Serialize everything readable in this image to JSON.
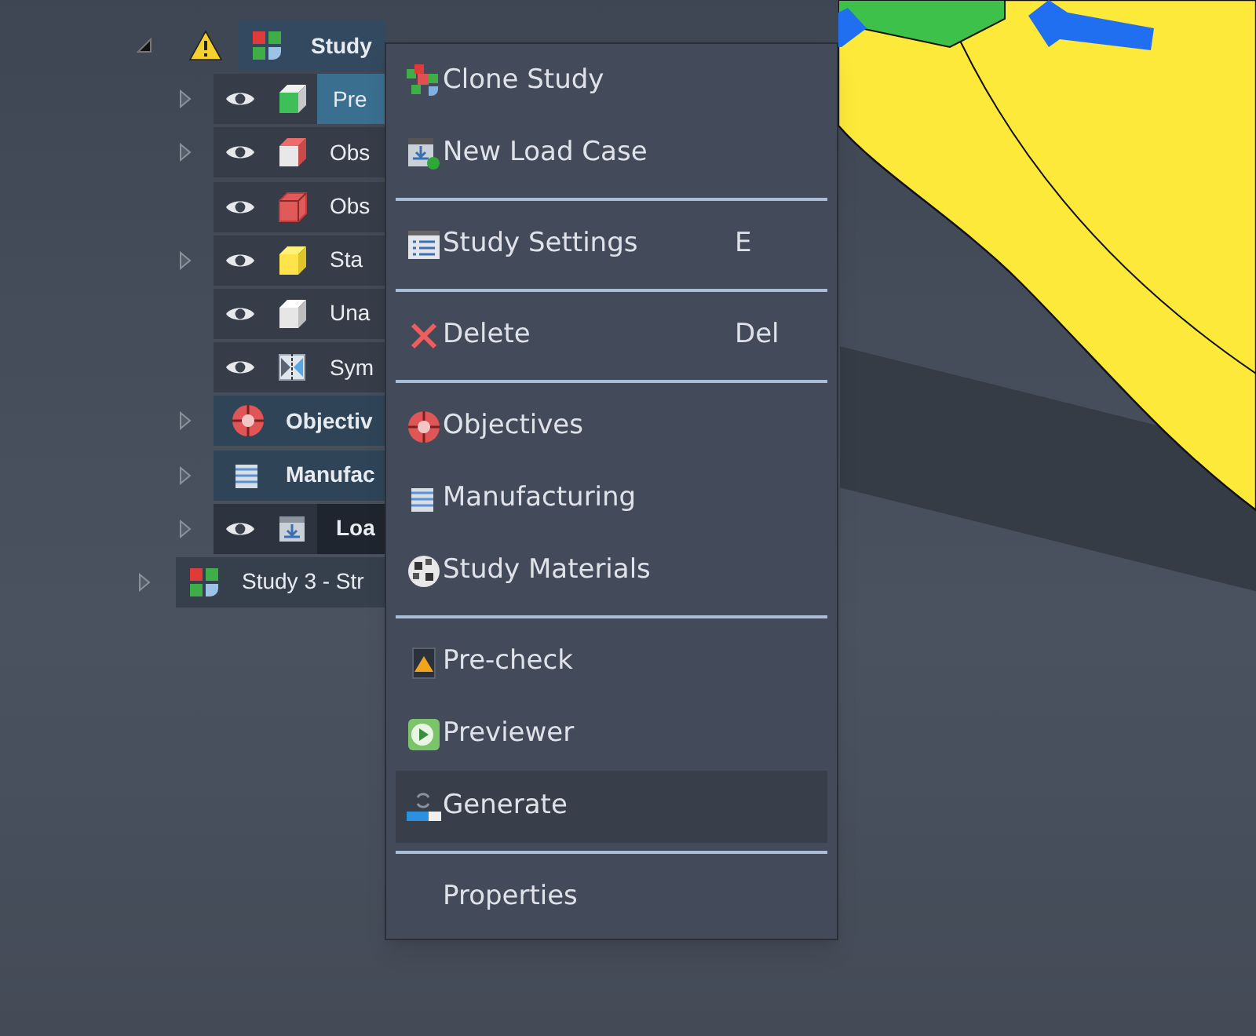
{
  "tree": [
    {
      "label": "Study",
      "kind": "study",
      "has_children": true,
      "expanded": true,
      "warning": true,
      "eye": false,
      "bold": true,
      "selected": false,
      "children": [
        {
          "label": "Pre",
          "kind": "preserve",
          "has_children": true,
          "expanded": false,
          "warning": false,
          "eye": true,
          "bold": false,
          "selected": true
        },
        {
          "label": "Obs",
          "kind": "obstacle",
          "has_children": true,
          "expanded": false,
          "warning": false,
          "eye": true,
          "bold": false,
          "selected": false
        },
        {
          "label": "Obs",
          "kind": "obstacle-frame",
          "has_children": false,
          "expanded": false,
          "warning": false,
          "eye": true,
          "bold": false,
          "selected": false
        },
        {
          "label": "Sta",
          "kind": "start",
          "has_children": true,
          "expanded": false,
          "warning": false,
          "eye": true,
          "bold": false,
          "selected": false
        },
        {
          "label": "Una",
          "kind": "unassigned",
          "has_children": false,
          "expanded": false,
          "warning": false,
          "eye": true,
          "bold": false,
          "selected": false
        },
        {
          "label": "Sym",
          "kind": "symmetry",
          "has_children": false,
          "expanded": false,
          "warning": false,
          "eye": true,
          "bold": false,
          "selected": false
        },
        {
          "label": "Objectiv",
          "kind": "objectives",
          "has_children": true,
          "expanded": false,
          "warning": false,
          "eye": false,
          "bold": true,
          "selected": false
        },
        {
          "label": "Manufac",
          "kind": "manufacturing",
          "has_children": true,
          "expanded": false,
          "warning": false,
          "eye": false,
          "bold": true,
          "selected": false
        },
        {
          "label": "Loa",
          "kind": "loadcase",
          "has_children": true,
          "expanded": false,
          "warning": false,
          "eye": true,
          "bold": true,
          "selected": false
        }
      ]
    },
    {
      "label": "Study 3 - Str",
      "kind": "study",
      "has_children": true,
      "expanded": false,
      "warning": false,
      "eye": false,
      "bold": false,
      "selected": false
    }
  ],
  "context_menu": {
    "groups": [
      [
        {
          "label": "Clone Study",
          "kind": "clone",
          "highlighted": false
        },
        {
          "label": "New Load Case",
          "kind": "loadcase",
          "highlighted": false
        }
      ],
      [
        {
          "label": "Study Settings",
          "kind": "settings",
          "shortcut": "E",
          "highlighted": false
        }
      ],
      [
        {
          "label": "Delete",
          "kind": "delete",
          "shortcut": "Del",
          "highlighted": false
        }
      ],
      [
        {
          "label": "Objectives",
          "kind": "objectives",
          "highlighted": false
        },
        {
          "label": "Manufacturing",
          "kind": "manufacturing",
          "highlighted": false
        },
        {
          "label": "Study Materials",
          "kind": "materials",
          "highlighted": false
        }
      ],
      [
        {
          "label": "Pre-check",
          "kind": "precheck",
          "highlighted": false
        },
        {
          "label": "Previewer",
          "kind": "previewer",
          "highlighted": false
        },
        {
          "label": "Generate",
          "kind": "generate",
          "highlighted": true
        }
      ],
      [
        {
          "label": "Properties",
          "kind": "plain",
          "highlighted": false
        }
      ]
    ]
  }
}
